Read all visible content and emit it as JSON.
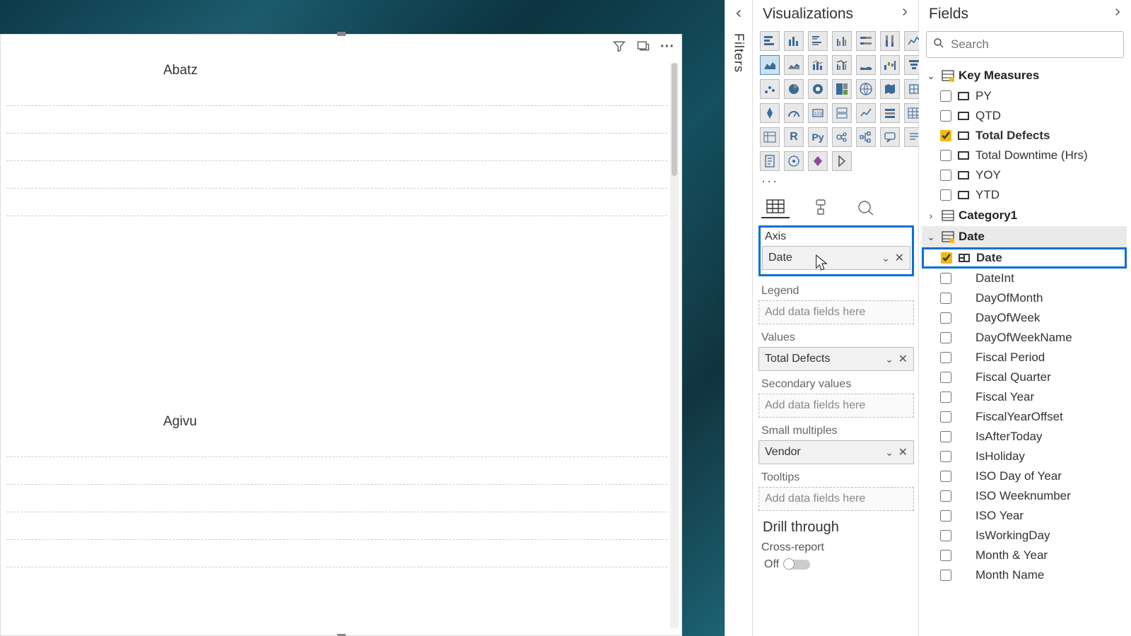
{
  "canvas": {
    "series": [
      "Abatz",
      "Agivu"
    ]
  },
  "filters": {
    "label": "Filters"
  },
  "viz": {
    "title": "Visualizations",
    "more": "···",
    "wells": {
      "axis": {
        "label": "Axis",
        "value": "Date"
      },
      "legend": {
        "label": "Legend",
        "placeholder": "Add data fields here"
      },
      "values": {
        "label": "Values",
        "value": "Total Defects"
      },
      "secondary": {
        "label": "Secondary values",
        "placeholder": "Add data fields here"
      },
      "small_multiples": {
        "label": "Small multiples",
        "value": "Vendor"
      },
      "tooltips": {
        "label": "Tooltips",
        "placeholder": "Add data fields here"
      }
    },
    "drill": {
      "title": "Drill through",
      "cross_label": "Cross-report",
      "toggle_state": "Off"
    }
  },
  "fields": {
    "title": "Fields",
    "search_placeholder": "Search",
    "tables": {
      "key_measures": {
        "name": "Key Measures",
        "fields": [
          {
            "name": "PY",
            "checked": false,
            "measure": true
          },
          {
            "name": "QTD",
            "checked": false,
            "measure": true
          },
          {
            "name": "Total Defects",
            "checked": true,
            "measure": true
          },
          {
            "name": "Total Downtime (Hrs)",
            "checked": false,
            "measure": true
          },
          {
            "name": "YOY",
            "checked": false,
            "measure": true
          },
          {
            "name": "YTD",
            "checked": false,
            "measure": true
          }
        ]
      },
      "category1": {
        "name": "Category1"
      },
      "date": {
        "name": "Date",
        "fields": [
          {
            "name": "Date",
            "checked": true,
            "highlight": true,
            "hierarchy": true
          },
          {
            "name": "DateInt",
            "checked": false
          },
          {
            "name": "DayOfMonth",
            "checked": false
          },
          {
            "name": "DayOfWeek",
            "checked": false
          },
          {
            "name": "DayOfWeekName",
            "checked": false
          },
          {
            "name": "Fiscal Period",
            "checked": false
          },
          {
            "name": "Fiscal Quarter",
            "checked": false
          },
          {
            "name": "Fiscal Year",
            "checked": false
          },
          {
            "name": "FiscalYearOffset",
            "checked": false
          },
          {
            "name": "IsAfterToday",
            "checked": false
          },
          {
            "name": "IsHoliday",
            "checked": false
          },
          {
            "name": "ISO Day of Year",
            "checked": false
          },
          {
            "name": "ISO Weeknumber",
            "checked": false
          },
          {
            "name": "ISO Year",
            "checked": false
          },
          {
            "name": "IsWorkingDay",
            "checked": false
          },
          {
            "name": "Month & Year",
            "checked": false
          },
          {
            "name": "Month Name",
            "checked": false
          }
        ]
      }
    }
  }
}
